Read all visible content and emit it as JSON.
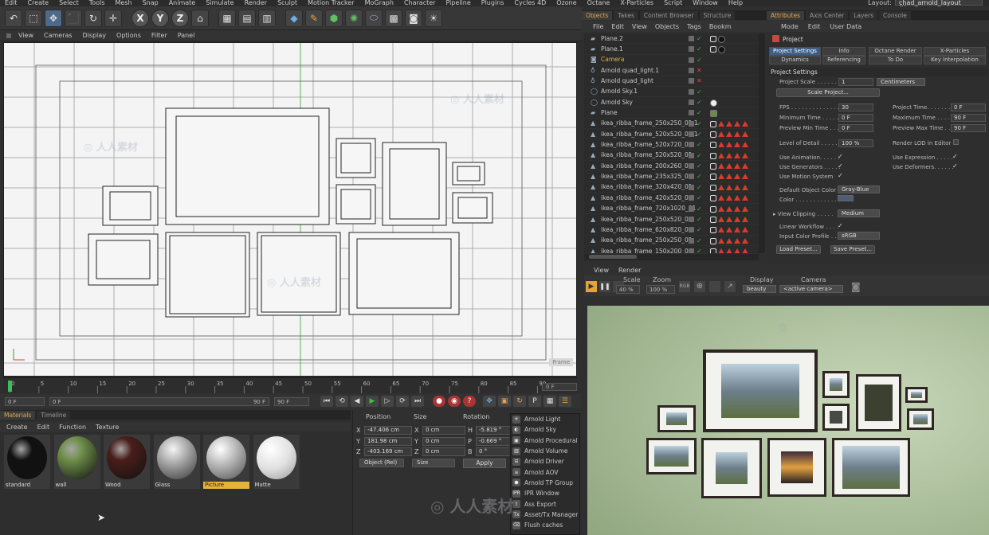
{
  "menubar": {
    "items": [
      "Edit",
      "Create",
      "Select",
      "Tools",
      "Mesh",
      "Snap",
      "Animate",
      "Simulate",
      "Render",
      "Sculpt",
      "Motion Tracker",
      "MoGraph",
      "Character",
      "Pipeline",
      "Plugins",
      "Cycles 4D",
      "Ozone",
      "Octane",
      "X-Particles",
      "Script",
      "Window",
      "Help"
    ],
    "layout_label": "Layout:",
    "layout_value": "chad_arnold_layout (User)"
  },
  "viewport": {
    "menu": [
      "View",
      "Cameras",
      "Display",
      "Options",
      "Filter",
      "Panel"
    ],
    "frame_label": "Frame"
  },
  "timeline": {
    "ticks": [
      "0",
      "5",
      "10",
      "15",
      "20",
      "25",
      "30",
      "35",
      "40",
      "45",
      "50",
      "55",
      "60",
      "65",
      "70",
      "75",
      "80",
      "85",
      "90"
    ],
    "end_field": "0 F",
    "current_frame": "0 F",
    "start_field": "0 F",
    "range_end": "90 F",
    "max_field": "90 F"
  },
  "materials": {
    "tabs": [
      "Materials",
      "Timeline"
    ],
    "menu": [
      "Create",
      "Edit",
      "Function",
      "Texture"
    ],
    "items": [
      {
        "name": "standard",
        "color": "#111111"
      },
      {
        "name": "wall",
        "color": "#6f8f4a"
      },
      {
        "name": "Wood",
        "color": "#4a1e1a"
      },
      {
        "name": "Glass",
        "color": "#c9c9c9"
      },
      {
        "name": "Picture",
        "color": "#b8b8b8"
      },
      {
        "name": "Matte",
        "color": "#e8e8e8"
      }
    ]
  },
  "coordinates": {
    "headers": [
      "Position",
      "Size",
      "Rotation"
    ],
    "rows": [
      {
        "axis": "X",
        "pos": "-47.406 cm",
        "saxis": "X",
        "size": "0 cm",
        "raxis": "H",
        "rot": "-5.819 °"
      },
      {
        "axis": "Y",
        "pos": "181.98 cm",
        "saxis": "Y",
        "size": "0 cm",
        "raxis": "P",
        "rot": "-0.669 °"
      },
      {
        "axis": "Z",
        "pos": "-403.169 cm",
        "saxis": "Z",
        "size": "0 cm",
        "raxis": "B",
        "rot": "0 °"
      }
    ],
    "mode_dropdown": "Object (Rel)",
    "size_dropdown": "Size",
    "apply_label": "Apply"
  },
  "arnold_menu": {
    "items": [
      {
        "label": "Arnold Light",
        "icon": "light-icon"
      },
      {
        "label": "Arnold Sky",
        "icon": "sky-icon"
      },
      {
        "label": "Arnold Procedural",
        "icon": "procedural-icon"
      },
      {
        "label": "Arnold Volume",
        "icon": "volume-icon"
      },
      {
        "label": "Arnold Driver",
        "icon": "driver-icon"
      },
      {
        "label": "Arnold AOV",
        "icon": "aov-icon"
      },
      {
        "label": "Arnold TP Group",
        "icon": "tp-group-icon"
      },
      {
        "label": "IPR Window",
        "icon": "ipr-icon"
      },
      {
        "label": "Ass Export",
        "icon": "export-icon"
      },
      {
        "label": "Asset/Tx Manager",
        "icon": "tx-manager-icon"
      },
      {
        "label": "Flush caches",
        "icon": "flush-icon"
      }
    ]
  },
  "objects": {
    "tabs": [
      "Objects",
      "Takes",
      "Content Browser",
      "Structure"
    ],
    "menu": [
      "File",
      "Edit",
      "View",
      "Objects",
      "Tags",
      "Bookm"
    ],
    "items": [
      {
        "name": "Plane.2",
        "type": "plane"
      },
      {
        "name": "Plane.1",
        "type": "plane"
      },
      {
        "name": "Camera",
        "type": "camera",
        "highlight": true
      },
      {
        "name": "Arnold quad_light.1",
        "type": "light"
      },
      {
        "name": "Arnold quad_light",
        "type": "light"
      },
      {
        "name": "Arnold Sky.1",
        "type": "sky"
      },
      {
        "name": "Arnold Sky",
        "type": "sky"
      },
      {
        "name": "Plane",
        "type": "plane"
      },
      {
        "name": "ikea_ribba_frame_250x250_01.1",
        "type": "mesh"
      },
      {
        "name": "ikea_ribba_frame_520x520_01.1",
        "type": "mesh"
      },
      {
        "name": "ikea_ribba_frame_520x720_01",
        "type": "mesh"
      },
      {
        "name": "ikea_ribba_frame_520x520_01",
        "type": "mesh"
      },
      {
        "name": "ikea_ribba_frame_200x260_01",
        "type": "mesh"
      },
      {
        "name": "ikea_ribba_frame_235x325_01",
        "type": "mesh"
      },
      {
        "name": "ikea_ribba_frame_320x420_01",
        "type": "mesh"
      },
      {
        "name": "ikea_ribba_frame_420x520_01",
        "type": "mesh"
      },
      {
        "name": "ikea_ribba_frame_720x1020_01",
        "type": "mesh"
      },
      {
        "name": "ikea_ribba_frame_250x520_01",
        "type": "mesh"
      },
      {
        "name": "ikea_ribba_frame_620x820_01",
        "type": "mesh"
      },
      {
        "name": "ikea_ribba_frame_250x250_01",
        "type": "mesh"
      },
      {
        "name": "ikea_ribba_frame_150x200_01",
        "type": "mesh"
      }
    ]
  },
  "attributes": {
    "tabs": [
      "Attributes",
      "Axis Center",
      "Layers",
      "Console"
    ],
    "menu": [
      "Mode",
      "Edit",
      "User Data"
    ],
    "title": "Project",
    "tab_buttons": [
      "Project Settings",
      "Info",
      "Octane Render",
      "X-Particles",
      "Dynamics",
      "Referencing",
      "To Do",
      "Key Interpolation"
    ],
    "section": "Project Settings",
    "project_scale_label": "Project Scale . . . . . .",
    "project_scale_value": "1",
    "project_scale_unit": "Centimeters",
    "scale_project_btn": "Scale Project...",
    "fps_label": "FPS . . . . . . . . . . . . . .",
    "fps_value": "30",
    "project_time_label": "Project Time. . . . . . .",
    "project_time_value": "0 F",
    "min_time_label": "Minimum Time . . . . .",
    "min_time_value": "0 F",
    "max_time_label": "Maximum Time . . . . .",
    "max_time_value": "90 F",
    "prev_min_label": "Preview Min Time . . .",
    "prev_min_value": "0 F",
    "prev_max_label": "Preview Max Time . . .",
    "prev_max_value": "90 F",
    "lod_label": "Level of Detail . . . . .",
    "lod_value": "100 %",
    "render_lod_label": "Render LOD in Editor",
    "use_anim_label": "Use Animation. . . . . .",
    "use_expr_label": "Use Expression . . . . .",
    "use_gen_label": "Use Generators . . . . .",
    "use_def_label": "Use Deformers. . . . . .",
    "use_motion_label": "Use Motion System",
    "default_color_label": "Default Object Color",
    "default_color_value": "Gray-Blue",
    "color_label": "Color . . . . . . . . . . . .",
    "view_clip_label": "View Clipping . . . . .",
    "view_clip_value": "Medium",
    "linear_wf_label": "Linear Workflow . . . .",
    "input_profile_label": "Input Color Profile . .",
    "input_profile_value": "sRGB",
    "load_preset": "Load Preset...",
    "save_preset": "Save Preset..."
  },
  "render_view": {
    "menu": [
      "View",
      "Render"
    ],
    "scale_label": "Scale",
    "scale_value": "40 %",
    "zoom_label": "Zoom",
    "zoom_value": "100 %",
    "display_label": "Display",
    "display_value": "beauty",
    "camera_label": "Camera",
    "camera_value": "<active camera>"
  },
  "colors": {
    "accent": "#4f6a88",
    "tab_active": "#e4a84a",
    "highlight": "#e3b33a"
  }
}
